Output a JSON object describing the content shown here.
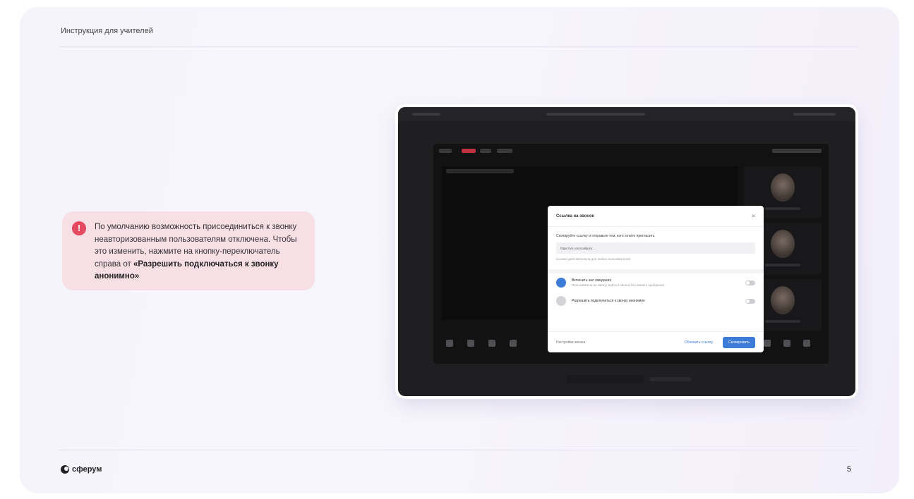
{
  "slide": {
    "title": "Инструкция для учителей",
    "page_number": "5",
    "logo_text": "сферум"
  },
  "callout": {
    "icon": "exclamation-icon",
    "icon_glyph": "!",
    "text_before": "По умолчанию возможность присоединиться к звонку неавторизованным пользователям отключена. Чтобы это изменить, нажмите на кнопку-переключатель справа от ",
    "text_bold": "«Разрешить подключаться к звонку анонимно»"
  },
  "dialog": {
    "title": "Ссылка на звонок",
    "close_glyph": "×",
    "hint": "Скопируйте ссылку и отправьте тем, кого хотите пригласить",
    "link": "https://vk.com/call/join/...",
    "sub_hint": "Ссылка действительна для любых пользователей",
    "row1_title": "Включить зал ожидания",
    "row1_sub": "Пользователи не смогут войти в звонок без вашего одобрения",
    "row2_title": "Разрешить подключаться к звонку анонимно",
    "footer_left": "Настройки звонка",
    "footer_mid": "Обновить ссылку",
    "footer_button": "Скопировать"
  },
  "colors": {
    "callout_bg": "#f8dfe6",
    "warning_red": "#e5475f",
    "accent_blue": "#3d7bd9",
    "frame_dark": "#1f1f21"
  }
}
